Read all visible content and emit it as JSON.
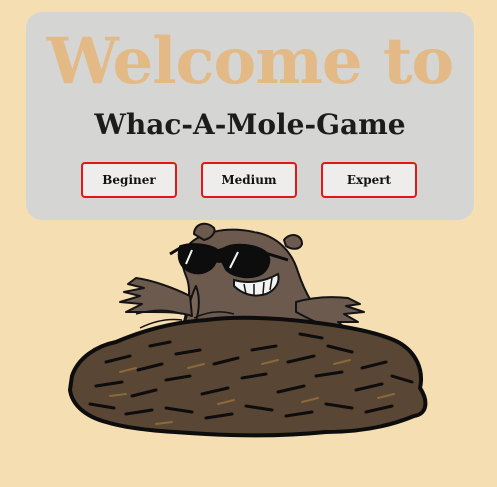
{
  "header": {
    "welcome_text": "Welcome to",
    "game_title": "Whac-A-Mole-Game"
  },
  "difficulty": {
    "buttons": [
      {
        "label": "Beginer"
      },
      {
        "label": "Medium"
      },
      {
        "label": "Expert"
      }
    ]
  },
  "theme": {
    "page_background": "#f6deb3",
    "panel_background": "#d5d5d3",
    "welcome_color": "#e3b985",
    "button_border": "#e01818",
    "mole_body": "#6d5a4f",
    "dirt_color": "#5a4634"
  },
  "illustration": {
    "name": "mole-with-sunglasses"
  }
}
